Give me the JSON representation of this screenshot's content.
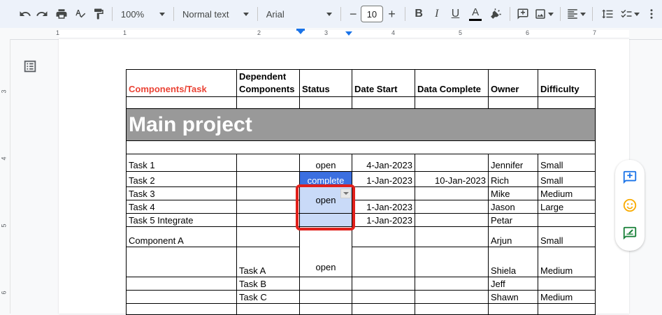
{
  "toolbar": {
    "zoom": "100%",
    "style": "Normal text",
    "font": "Arial",
    "font_size": "10",
    "icons": [
      "undo-icon",
      "redo-icon",
      "print-icon",
      "spellcheck-icon",
      "paint-format-icon",
      "bold-icon",
      "italic-icon",
      "underline-icon",
      "text-color-icon",
      "highlight-icon",
      "add-comment-icon",
      "insert-image-icon",
      "align-icon",
      "line-spacing-icon",
      "checklist-icon",
      "more-icon"
    ]
  },
  "ruler": {
    "h_numbers": [
      "1",
      "1",
      "2",
      "3",
      "4",
      "5",
      "6",
      "7"
    ],
    "v_numbers": [
      "3",
      "4",
      "5",
      "6"
    ]
  },
  "table": {
    "headers": [
      "Components/Task",
      "Dependent Components",
      "Status",
      "Date Start",
      "Data Complete",
      "Owner",
      "Difficulty"
    ],
    "banner": "Main project",
    "rows": [
      [
        "Task 1",
        "",
        "open",
        "4-Jan-2023",
        "",
        "Jennifer",
        "Small"
      ],
      [
        "Task 2",
        "",
        "complete",
        "1-Jan-2023",
        "10-Jan-2023",
        "Rich",
        "Small"
      ],
      [
        "Task 3",
        "",
        "",
        "",
        "",
        "Mike",
        "Medium"
      ],
      [
        "Task 4",
        "",
        "open",
        "1-Jan-2023",
        "",
        "Jason",
        "Large"
      ],
      [
        "Task 5 Integrate",
        "",
        "",
        "1-Jan-2023",
        "",
        "Petar",
        ""
      ],
      [
        "Component A",
        "",
        "",
        "",
        "",
        "Arjun",
        "Small"
      ],
      [
        "",
        "Task A",
        "open",
        "",
        "",
        "Shiela",
        "Medium"
      ],
      [
        "",
        "Task B",
        "",
        "",
        "",
        "Jeff",
        ""
      ],
      [
        "",
        "Task C",
        "",
        "",
        "",
        "Shawn",
        "Medium"
      ]
    ]
  },
  "colors": {
    "header_red": "#ea4335",
    "banner_gray": "#999999",
    "complete_blue": "#3b6fe0",
    "open_light_blue": "#c9daf8",
    "highlight_red": "#e0201b"
  }
}
